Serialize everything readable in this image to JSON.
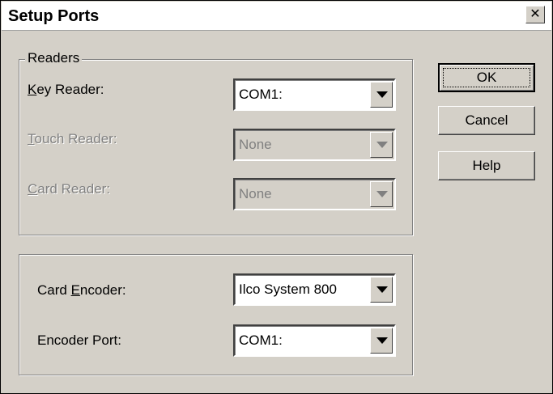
{
  "dialog": {
    "title": "Setup Ports",
    "close_glyph": "✕"
  },
  "readers_group": {
    "legend": "Readers",
    "key_reader": {
      "label_mnemonic": "K",
      "label_rest": "ey Reader:",
      "value": "COM1:",
      "enabled": true
    },
    "touch_reader": {
      "label_mnemonic": "T",
      "label_rest": "ouch Reader:",
      "value": "None",
      "enabled": false
    },
    "card_reader": {
      "label_mnemonic": "C",
      "label_rest": "ard Reader:",
      "value": "None",
      "enabled": false
    }
  },
  "encoder_group": {
    "card_encoder": {
      "label_pre": "Card ",
      "label_mnemonic": "E",
      "label_rest": "ncoder:",
      "value": "Ilco System 800",
      "enabled": true
    },
    "encoder_port": {
      "label": "Encoder Port:",
      "value": "COM1:",
      "enabled": true
    }
  },
  "buttons": {
    "ok": "OK",
    "cancel": "Cancel",
    "help": "Help"
  },
  "icons": {
    "close": "close-icon",
    "dropdown": "chevron-down-icon"
  },
  "colors": {
    "face": "#d4d0c8",
    "disabled_text": "#808080",
    "field_background": "#ffffff"
  }
}
